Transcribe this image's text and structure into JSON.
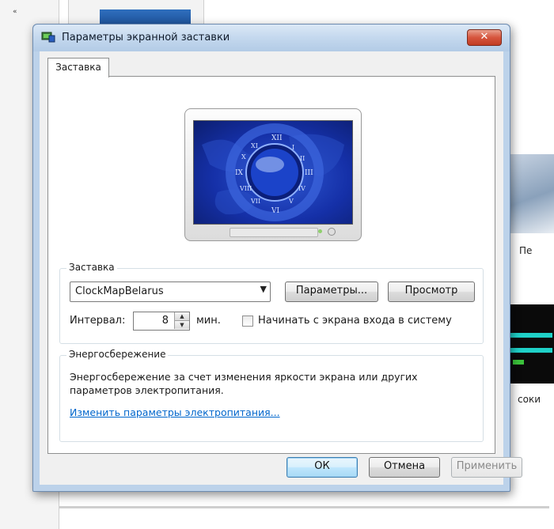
{
  "dialog": {
    "title": "Параметры экранной заставки",
    "close_label": "✕",
    "tab_label": "Заставка"
  },
  "screensaver": {
    "group_label": "Заставка",
    "selected": "ClockMapBelarus",
    "params_button": "Параметры...",
    "preview_button": "Просмотр",
    "interval_label": "Интервал:",
    "interval_value": "8",
    "interval_unit": "мин.",
    "logon_checkbox_label": "Начинать с экрана входа в систему",
    "logon_checked": false
  },
  "power": {
    "group_label": "Энергосбережение",
    "description": "Энергосбережение за счет изменения яркости экрана или других параметров электропитания.",
    "link": "Изменить параметры электропитания..."
  },
  "footer": {
    "ok": "ОК",
    "cancel": "Отмена",
    "apply": "Применить"
  },
  "background": {
    "left_mark": "«",
    "right_label_1": "Пе",
    "right_label_2": "соки"
  },
  "colors": {
    "accent": "#0066cc",
    "screen_blue": "#1530a8",
    "close_red": "#d6553d"
  }
}
